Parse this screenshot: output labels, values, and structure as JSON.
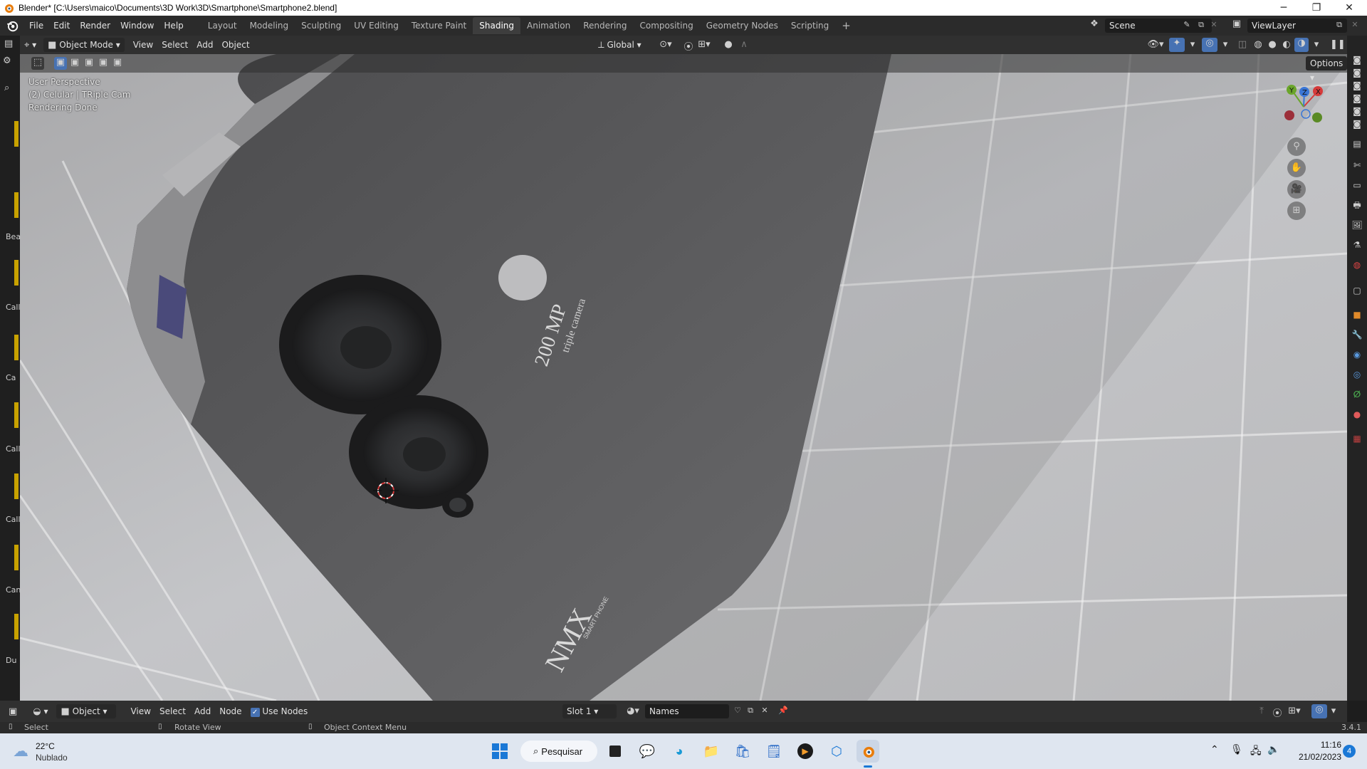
{
  "window": {
    "title": "Blender* [C:\\Users\\maico\\Documents\\3D Work\\3D\\Smartphone\\Smartphone2.blend]",
    "minimize": "─",
    "maximize": "❐",
    "close": "✕"
  },
  "menus": [
    "File",
    "Edit",
    "Render",
    "Window",
    "Help"
  ],
  "workspace_tabs": [
    {
      "label": "Layout",
      "active": false
    },
    {
      "label": "Modeling",
      "active": false
    },
    {
      "label": "Sculpting",
      "active": false
    },
    {
      "label": "UV Editing",
      "active": false
    },
    {
      "label": "Texture Paint",
      "active": false
    },
    {
      "label": "Shading",
      "active": true
    },
    {
      "label": "Animation",
      "active": false
    },
    {
      "label": "Rendering",
      "active": false
    },
    {
      "label": "Compositing",
      "active": false
    },
    {
      "label": "Geometry Nodes",
      "active": false
    },
    {
      "label": "Scripting",
      "active": false
    }
  ],
  "add_workspace": "+",
  "scene": {
    "name": "Scene"
  },
  "view_layer": {
    "name": "ViewLayer"
  },
  "header": {
    "mode": "Object Mode",
    "view": "View",
    "select": "Select",
    "add": "Add",
    "object": "Object",
    "transform_orientation": "Global",
    "options": "Options"
  },
  "viewport": {
    "perspective": "User Perspective",
    "object_info": "(2) Celular | TRiple Cam",
    "status": "Rendering Done",
    "label_200mp": "200 MP",
    "label_triple": "triple camera",
    "brand": "NMX",
    "brand_sub": "SMART PHONE"
  },
  "gizmo": {
    "x": "X",
    "y": "Y",
    "z": "Z"
  },
  "outliner_labels": [
    "Bea",
    "Call",
    "Ca",
    "Call",
    "Call",
    "Can",
    "Du"
  ],
  "bottom_header": {
    "editor_type": "Object",
    "view": "View",
    "select": "Select",
    "add": "Add",
    "node": "Node",
    "use_nodes": "Use Nodes",
    "slot": "Slot 1",
    "names": "Names"
  },
  "statusbar": {
    "select": "Select",
    "rotate": "Rotate View",
    "context": "Object Context Menu",
    "version": "3.4.1"
  },
  "taskbar": {
    "temperature": "22°C",
    "weather": "Nublado",
    "search": "Pesquisar",
    "time": "11:16",
    "date": "21/02/2023",
    "notifications": "4"
  }
}
